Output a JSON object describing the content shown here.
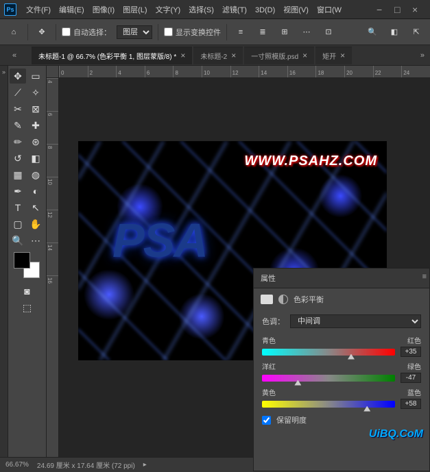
{
  "menu": [
    "文件(F)",
    "编辑(E)",
    "图像(I)",
    "图层(L)",
    "文字(Y)",
    "选择(S)",
    "滤镜(T)",
    "3D(D)",
    "视图(V)",
    "窗口(W"
  ],
  "options": {
    "auto_select_label": "自动选择：",
    "auto_select_value": "图层",
    "show_transform_label": "显示变换控件"
  },
  "tabs": [
    {
      "label": "未标题-1 @ 66.7% (色彩平衡 1, 图层蒙版/8) *",
      "active": true
    },
    {
      "label": "未标题-2",
      "active": false
    },
    {
      "label": "一寸照模版.psd",
      "active": false
    },
    {
      "label": "矩开",
      "active": false
    }
  ],
  "ruler_h": [
    "0",
    "2",
    "4",
    "6",
    "8",
    "10",
    "12",
    "14",
    "16",
    "18",
    "20",
    "22",
    "24"
  ],
  "ruler_v": [
    "4",
    "6",
    "8",
    "10",
    "12",
    "14",
    "16"
  ],
  "canvas": {
    "url_text": "WWW.PSAHZ.COM",
    "psa_text": "PSA"
  },
  "panel": {
    "tab": "属性",
    "title": "色彩平衡",
    "tone_label": "色调：",
    "tone_value": "中间调",
    "sliders": [
      {
        "left": "青色",
        "right": "红色",
        "value": "+35",
        "pos": 67,
        "track": "track-cr"
      },
      {
        "left": "洋红",
        "right": "绿色",
        "value": "-47",
        "pos": 27,
        "track": "track-mg"
      },
      {
        "left": "黄色",
        "right": "蓝色",
        "value": "+58",
        "pos": 79,
        "track": "track-yb"
      }
    ],
    "preserve_label": "保留明度"
  },
  "status": {
    "zoom": "66.67%",
    "dims": "24.69 厘米 x 17.64 厘米 (72 ppi)"
  },
  "watermark": "UiBQ.CoM"
}
